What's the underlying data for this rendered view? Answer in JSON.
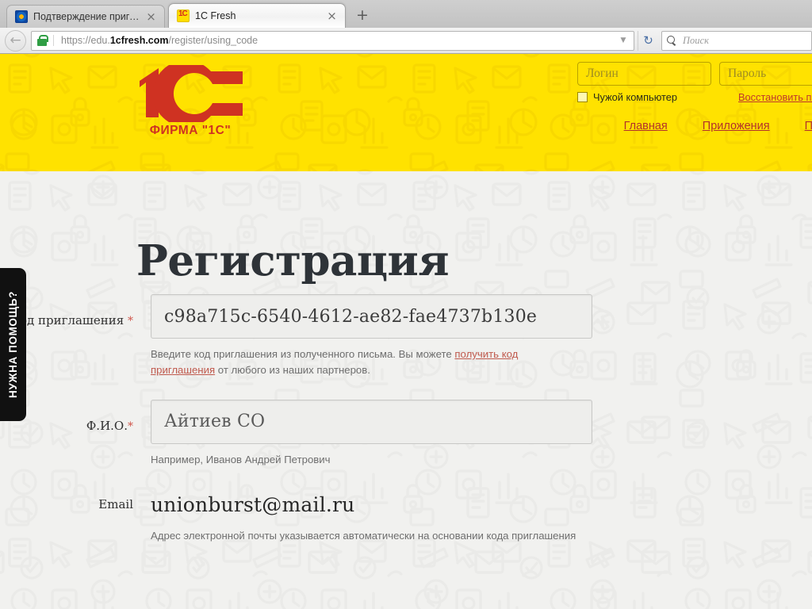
{
  "browser": {
    "tabs": [
      {
        "title": "Подтверждение приглаш...",
        "favicon": "generic-site-icon",
        "active": false,
        "close_label": "×"
      },
      {
        "title": "1C Fresh",
        "favicon": "1c-favicon",
        "active": true,
        "close_label": "×"
      }
    ],
    "new_tab_label": "+",
    "back_label": "←",
    "url": {
      "scheme": "https://edu.",
      "domain": "1cfresh.com",
      "path": "/register/using_code",
      "full": "https://edu.1cfresh.com/register/using_code"
    },
    "url_dropdown_label": "▼",
    "reload_label": "↻",
    "search_placeholder": "Поиск"
  },
  "site_header": {
    "logo": {
      "mark_text": "1C",
      "caption": "ФИРМА \"1С\"",
      "color": "#cf3222"
    },
    "background_color": "#ffe200",
    "account": {
      "login_placeholder": "Логин",
      "password_placeholder": "Пароль",
      "foreign_computer_label": "Чужой компьютер",
      "restore_link": "Восстановить пароль"
    },
    "nav": [
      {
        "label": "Главная"
      },
      {
        "label": "Приложения"
      },
      {
        "label": "Преимущества"
      }
    ]
  },
  "help_tab": {
    "label": "НУЖНА ПОМОЩЬ?"
  },
  "page": {
    "title": "Регистрация",
    "form": {
      "invite_code": {
        "label": "Код приглашения",
        "required_marker": "*",
        "value": "c98a715c-6540-4612-ae82-fae4737b130e",
        "hint_before_link": "Введите код приглашения из полученного письма. Вы можете ",
        "hint_link": "получить код приглашения",
        "hint_after_link": " от любого из наших партнеров."
      },
      "full_name": {
        "label": "Ф.И.О.",
        "required_marker": "*",
        "value": "Айтиев СО",
        "hint": "Например, Иванов Андрей Петрович"
      },
      "email": {
        "label": "Email",
        "value": "unionburst@mail.ru",
        "hint": "Адрес электронной почты указывается автоматически на основании кода приглашения"
      }
    }
  }
}
